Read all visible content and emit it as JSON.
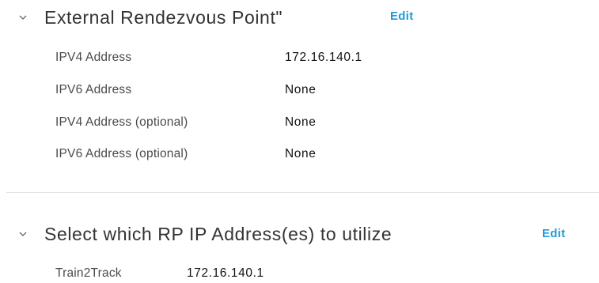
{
  "rendezvous": {
    "title": "External Rendezvous Point\"",
    "edit_label": "Edit",
    "rows": [
      {
        "label": "IPV4 Address",
        "value": "172.16.140.1"
      },
      {
        "label": "IPV6 Address",
        "value": "None"
      },
      {
        "label": "IPV4 Address (optional)",
        "value": "None"
      },
      {
        "label": "IPV6 Address (optional)",
        "value": "None"
      }
    ]
  },
  "rp_select": {
    "title": "Select which RP IP Address(es) to utilize",
    "edit_label": "Edit",
    "rows": [
      {
        "label": "Train2Track",
        "value": "172.16.140.1"
      }
    ]
  },
  "icons": {
    "collapse": "chevron-down-icon"
  }
}
